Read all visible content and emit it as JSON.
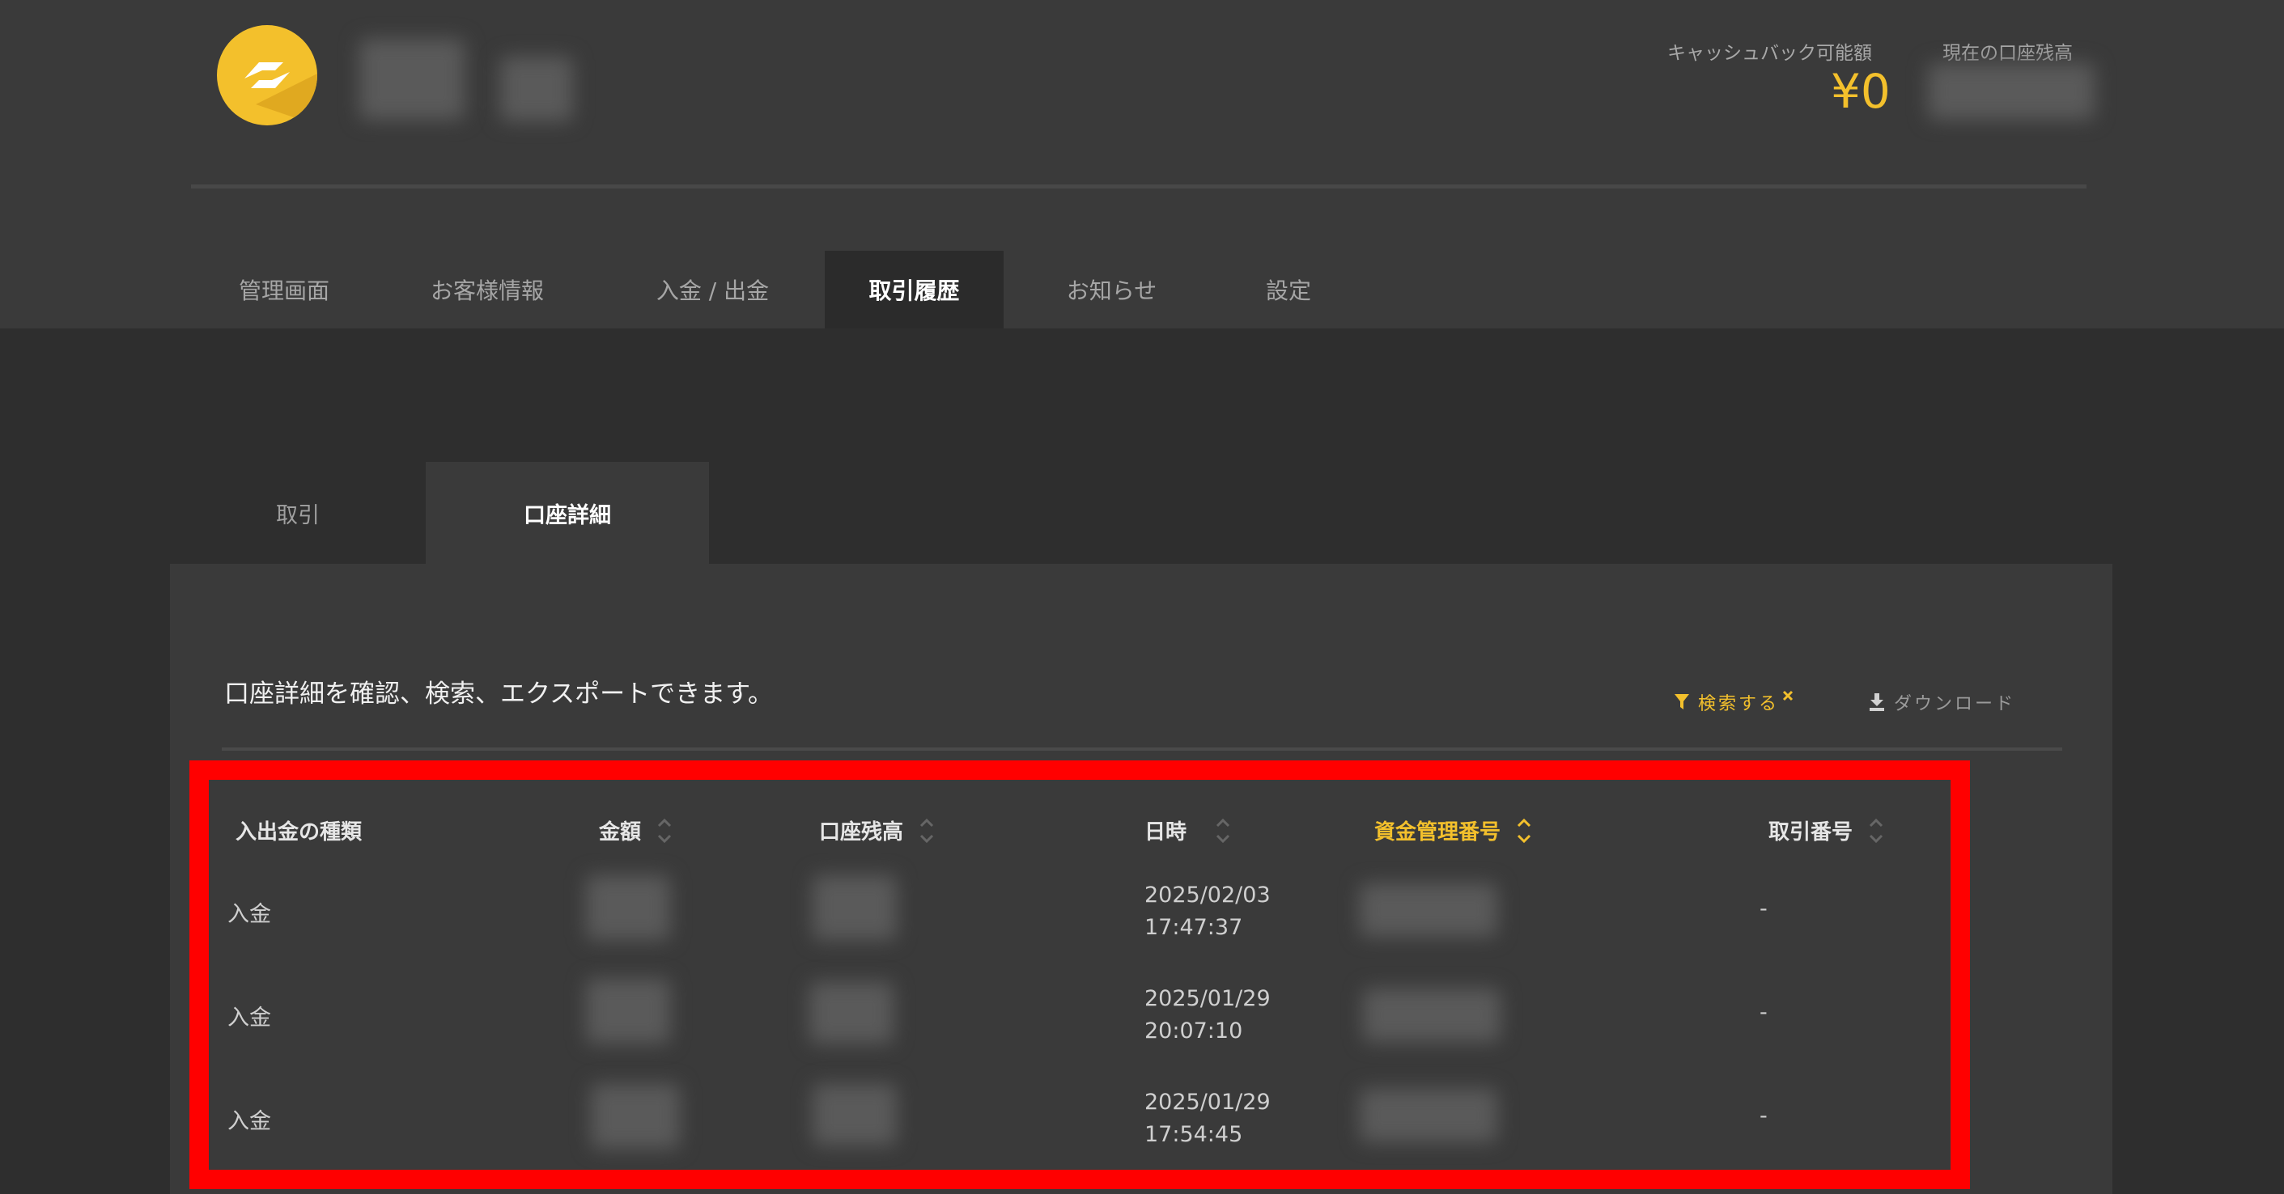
{
  "header": {
    "cashback_label": "キャッシュバック可能額",
    "cashback_value": "¥0",
    "balance_label": "現在の口座残高"
  },
  "nav": [
    "管理画面",
    "お客様情報",
    "入金 / 出金",
    "取引履歴",
    "お知らせ",
    "設定"
  ],
  "nav_active": "取引履歴",
  "subtabs": [
    "取引",
    "口座詳細"
  ],
  "subtab_active": "口座詳細",
  "panel": {
    "description": "口座詳細を確認、検索、エクスポートできます。",
    "search_label": "検索する",
    "download_label": "ダウンロード"
  },
  "table": {
    "columns": [
      "入出金の種類",
      "金額",
      "口座残高",
      "日時",
      "資金管理番号",
      "取引番号"
    ],
    "sorted_column": "資金管理番号",
    "rows": [
      {
        "type": "入金",
        "date": "2025/02/03",
        "time": "17:47:37",
        "tx": "-"
      },
      {
        "type": "入金",
        "date": "2025/01/29",
        "time": "20:07:10",
        "tx": "-"
      },
      {
        "type": "入金",
        "date": "2025/01/29",
        "time": "17:54:45",
        "tx": "-"
      }
    ]
  },
  "colors": {
    "accent": "#f3c02c",
    "highlight": "#ff0000"
  },
  "icons": [
    "logo-icon",
    "filter-icon",
    "close-icon",
    "download-icon",
    "sort-icon"
  ]
}
